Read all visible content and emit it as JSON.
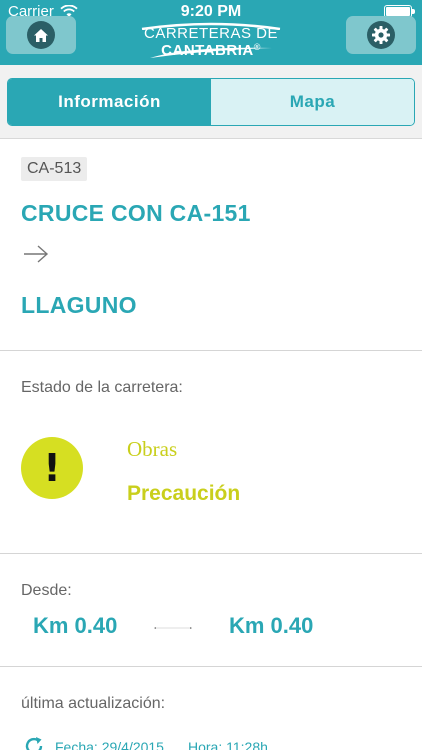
{
  "status_bar": {
    "carrier": "Carrier",
    "time": "9:20 PM"
  },
  "header": {
    "brand_prefix": "CARRETERAS DE ",
    "brand_bold": "CANTABRIA",
    "brand_mark": "®",
    "home_icon": "home-icon",
    "settings_icon": "gear-icon",
    "color": "#2aa7b4"
  },
  "tabs": [
    {
      "label": "Información",
      "active": true
    },
    {
      "label": "Mapa",
      "active": false
    }
  ],
  "route": {
    "code": "CA-513",
    "from": "CRUCE CON CA-151",
    "to": "LLAGUNO",
    "arrow_icon": "arrow-right-icon"
  },
  "status": {
    "label": "Estado de la carretera:",
    "icon": "warning-icon",
    "icon_glyph": "!",
    "type": "Obras",
    "level": "Precaución",
    "color": "#d6df22"
  },
  "from": {
    "label": "Desde:",
    "km_start": "Km 0.40",
    "km_end": "Km 0.40"
  },
  "update": {
    "label": "última actualización:",
    "icon": "refresh-icon",
    "date": "Fecha: 29/4/2015",
    "time": "Hora: 11:28h"
  }
}
